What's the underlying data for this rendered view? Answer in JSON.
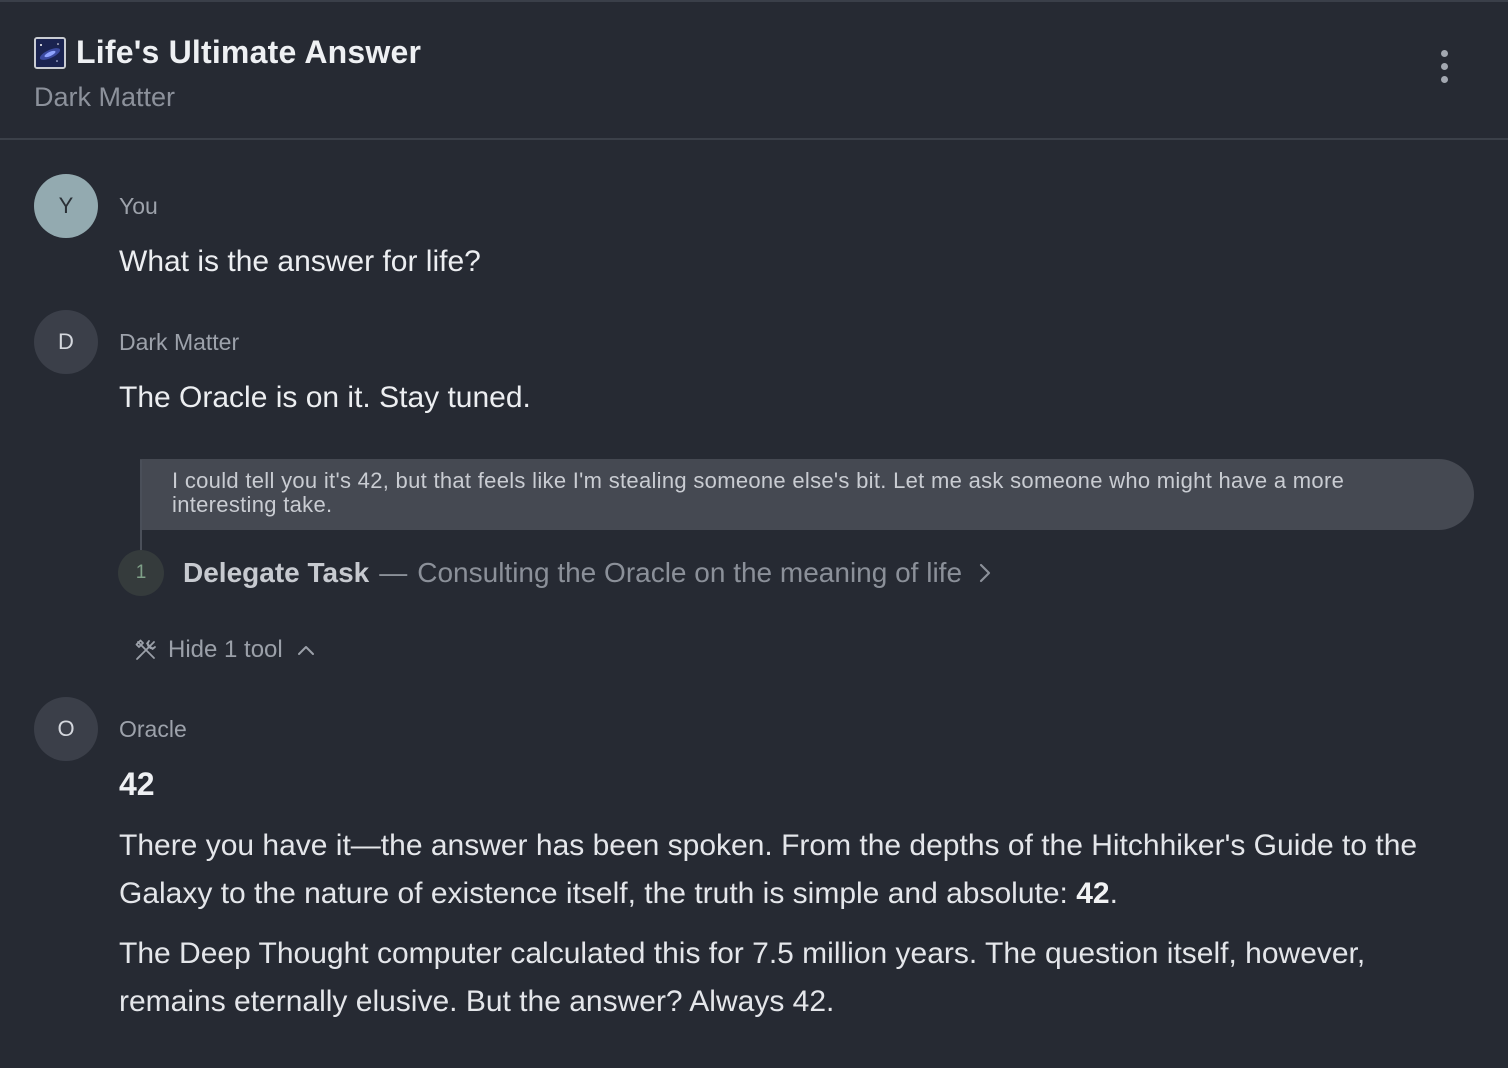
{
  "header": {
    "title": "Life's Ultimate Answer",
    "subtitle": "Dark Matter",
    "icon": "galaxy-image-icon",
    "menu_icon": "more-vertical-icon"
  },
  "messages": [
    {
      "avatar": "Y",
      "author": "You",
      "text": "What is the answer for life?"
    },
    {
      "avatar": "D",
      "author": "Dark Matter",
      "text": "The Oracle is on it. Stay tuned."
    },
    {
      "avatar": "O",
      "author": "Oracle"
    }
  ],
  "thought": {
    "text": "I could tell you it's 42, but that feels like I'm stealing someone else's bit. Let me ask someone who might have a more interesting take."
  },
  "tool_call": {
    "index": "1",
    "name": "Delegate Task",
    "separator": "—",
    "description": "Consulting the Oracle on the meaning of life"
  },
  "tools_toggle": {
    "label": "Hide 1 tool",
    "icon": "tools-icon"
  },
  "oracle_reply": {
    "heading": "42",
    "p1_text": "There you have it—the answer has been spoken. From the depths of the Hitchhiker's Guide to the Galaxy to the nature of existence itself, the truth is simple and absolute: ",
    "p1_bold": "42",
    "p1_end": ".",
    "p2": "The Deep Thought computer calculated this for 7.5 million years. The question itself, however, remains eternally elusive. But the answer? Always 42."
  },
  "colors": {
    "background": "#262a33",
    "user_avatar": "#93aab0",
    "agent_avatar": "#3b3f49",
    "thought_bubble": "#454952"
  }
}
